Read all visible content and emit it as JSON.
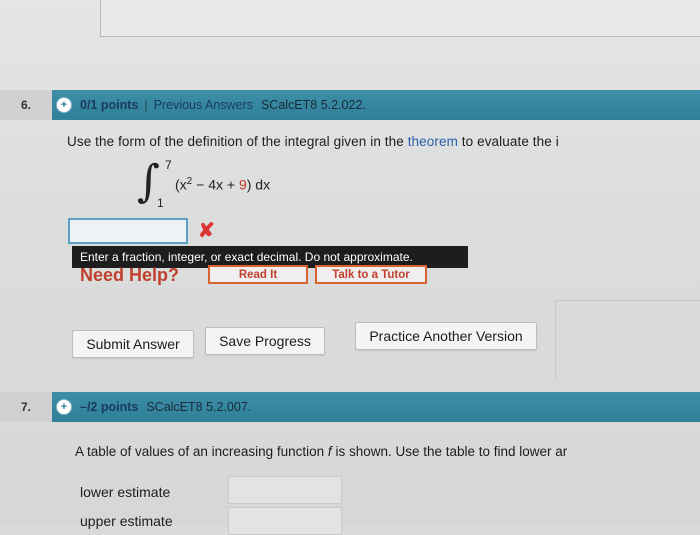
{
  "q6": {
    "number": "6.",
    "points": "0/1 points",
    "separator": "|",
    "previous_answers": "Previous Answers",
    "code": "SCalcET8 5.2.022.",
    "prompt_before": "Use the form of the definition of the integral given in the ",
    "prompt_link": "theorem",
    "prompt_after": " to evaluate the i",
    "integral": {
      "upper": "7",
      "lower": "1",
      "expr_open": "(x",
      "expr_exp": "2",
      "expr_mid": " − 4x + ",
      "expr_red": "9",
      "expr_close": ") dx"
    },
    "answer_value": "",
    "tooltip": "Enter a fraction, integer, or exact decimal. Do not approximate.",
    "need_help": "Need Help?",
    "read_it": "Read It",
    "talk_tutor": "Talk to a Tutor",
    "submit_answer": "Submit Answer",
    "save_progress": "Save Progress",
    "practice_another": "Practice Another Version"
  },
  "q7": {
    "number": "7.",
    "points": "–/2 points",
    "code": "SCalcET8 5.2.007.",
    "prompt_before": "A table of values of an increasing function ",
    "prompt_var": "f",
    "prompt_after": " is shown. Use the table to find lower ar",
    "lower_estimate": "lower estimate",
    "upper_estimate": "upper estimate"
  },
  "colors": {
    "header_bar": "#2f7f98",
    "help_red": "#c0402e",
    "error_x": "#dd3333"
  }
}
